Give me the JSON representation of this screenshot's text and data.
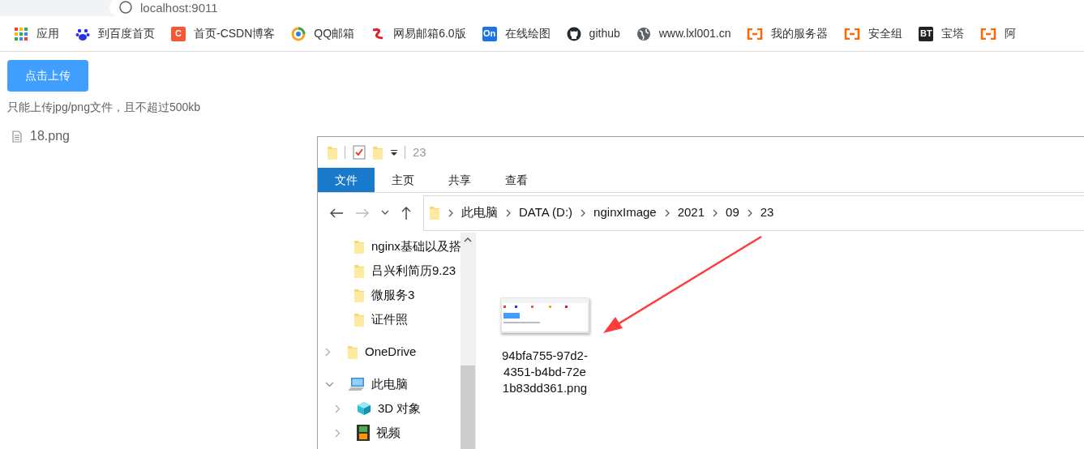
{
  "browser": {
    "url": "localhost:9011"
  },
  "bookmarks": [
    {
      "label": "应用",
      "kind": "apps"
    },
    {
      "label": "到百度首页",
      "kind": "paw"
    },
    {
      "label": "首页-CSDN博客",
      "kind": "letter",
      "icon_text": "C",
      "color": "#fc5531"
    },
    {
      "label": "QQ邮箱",
      "kind": "ring"
    },
    {
      "label": "网易邮箱6.0版",
      "kind": "mail163"
    },
    {
      "label": "在线绘图",
      "kind": "letter",
      "icon_text": "On",
      "color": "#1a73e8"
    },
    {
      "label": "github",
      "kind": "octocat"
    },
    {
      "label": "www.lxl001.cn",
      "kind": "globe"
    },
    {
      "label": "我的服务器",
      "kind": "bracket"
    },
    {
      "label": "安全组",
      "kind": "bracket"
    },
    {
      "label": "宝塔",
      "kind": "letter",
      "icon_text": "BT",
      "color": "#222222"
    },
    {
      "label": "阿",
      "kind": "bracket"
    }
  ],
  "upload": {
    "button": "点击上传",
    "hint": "只能上传jpg/png文件，且不超过500kb",
    "files": [
      "18.png"
    ]
  },
  "explorer": {
    "title": "23",
    "ribbon_tabs": [
      {
        "label": "文件",
        "selected": true
      },
      {
        "label": "主页",
        "selected": false
      },
      {
        "label": "共享",
        "selected": false
      },
      {
        "label": "查看",
        "selected": false
      }
    ],
    "breadcrumb": [
      "此电脑",
      "DATA (D:)",
      "nginxImage",
      "2021",
      "09",
      "23"
    ],
    "pinned": [
      {
        "label": "nginx基础以及搭"
      },
      {
        "label": "吕兴利简历9.23"
      },
      {
        "label": "微服务3"
      },
      {
        "label": "证件照"
      }
    ],
    "tree": [
      {
        "label": "OneDrive",
        "kind": "folder",
        "expanded": false
      },
      {
        "label": "此电脑",
        "kind": "computer",
        "expanded": true,
        "children": [
          {
            "label": "3D 对象",
            "kind": "cube",
            "expanded": false
          },
          {
            "label": "视频",
            "kind": "film",
            "expanded": false
          }
        ]
      }
    ],
    "files": [
      {
        "name": "94bfa755-97d2-4351-b4bd-72e1b83dd361.png"
      }
    ]
  }
}
